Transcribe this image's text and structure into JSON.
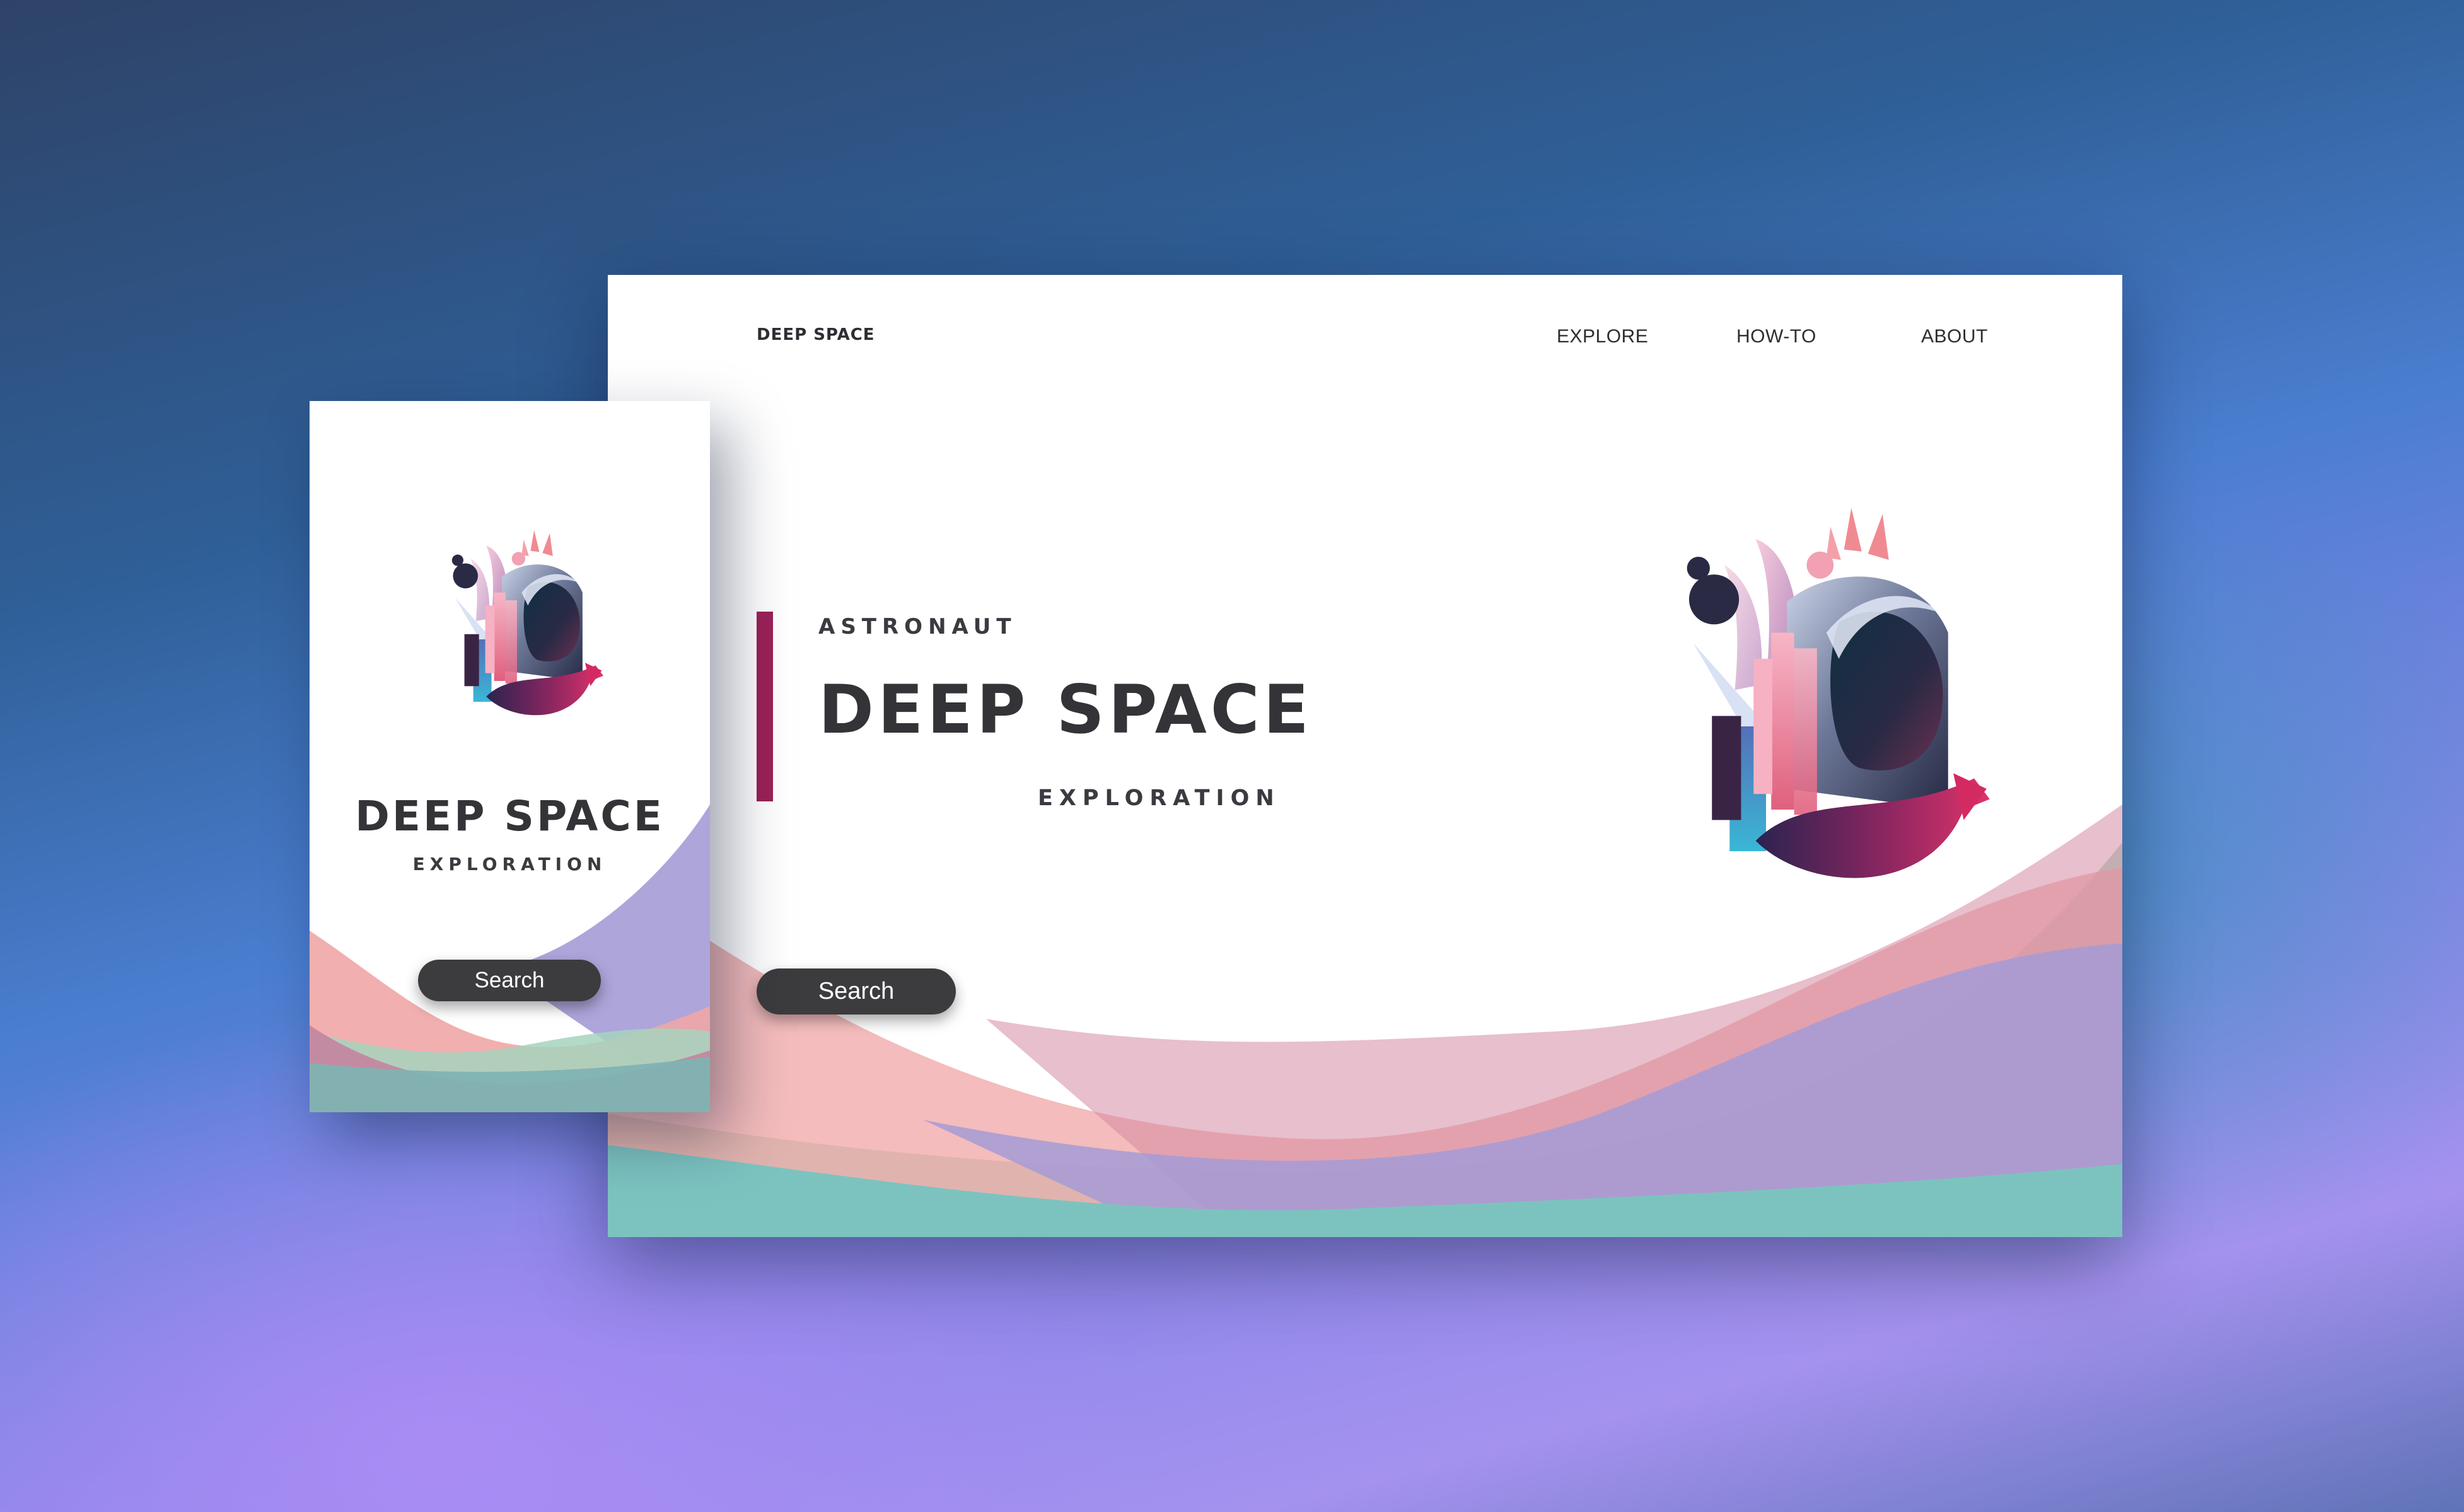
{
  "desktop": {
    "brand": "DEEP SPACE",
    "nav": {
      "explore": "EXPLORE",
      "howto": "HOW-TO",
      "about": "ABOUT"
    },
    "hero": {
      "eyebrow": "ASTRONAUT",
      "title": "DEEP SPACE",
      "subtitle": "EXPLORATION",
      "search_label": "Search"
    },
    "illustration": "astronaut-helmet"
  },
  "mobile": {
    "title": "DEEP SPACE",
    "subtitle": "EXPLORATION",
    "search_label": "Search",
    "illustration": "astronaut-helmet"
  },
  "colors": {
    "accent": "#9b2257",
    "button": "#3c3c3f",
    "wave_pink": "#f0a6a6",
    "wave_purple": "#a59bd6",
    "wave_teal": "#7cc3c0",
    "wave_green": "#a6d3bd"
  }
}
